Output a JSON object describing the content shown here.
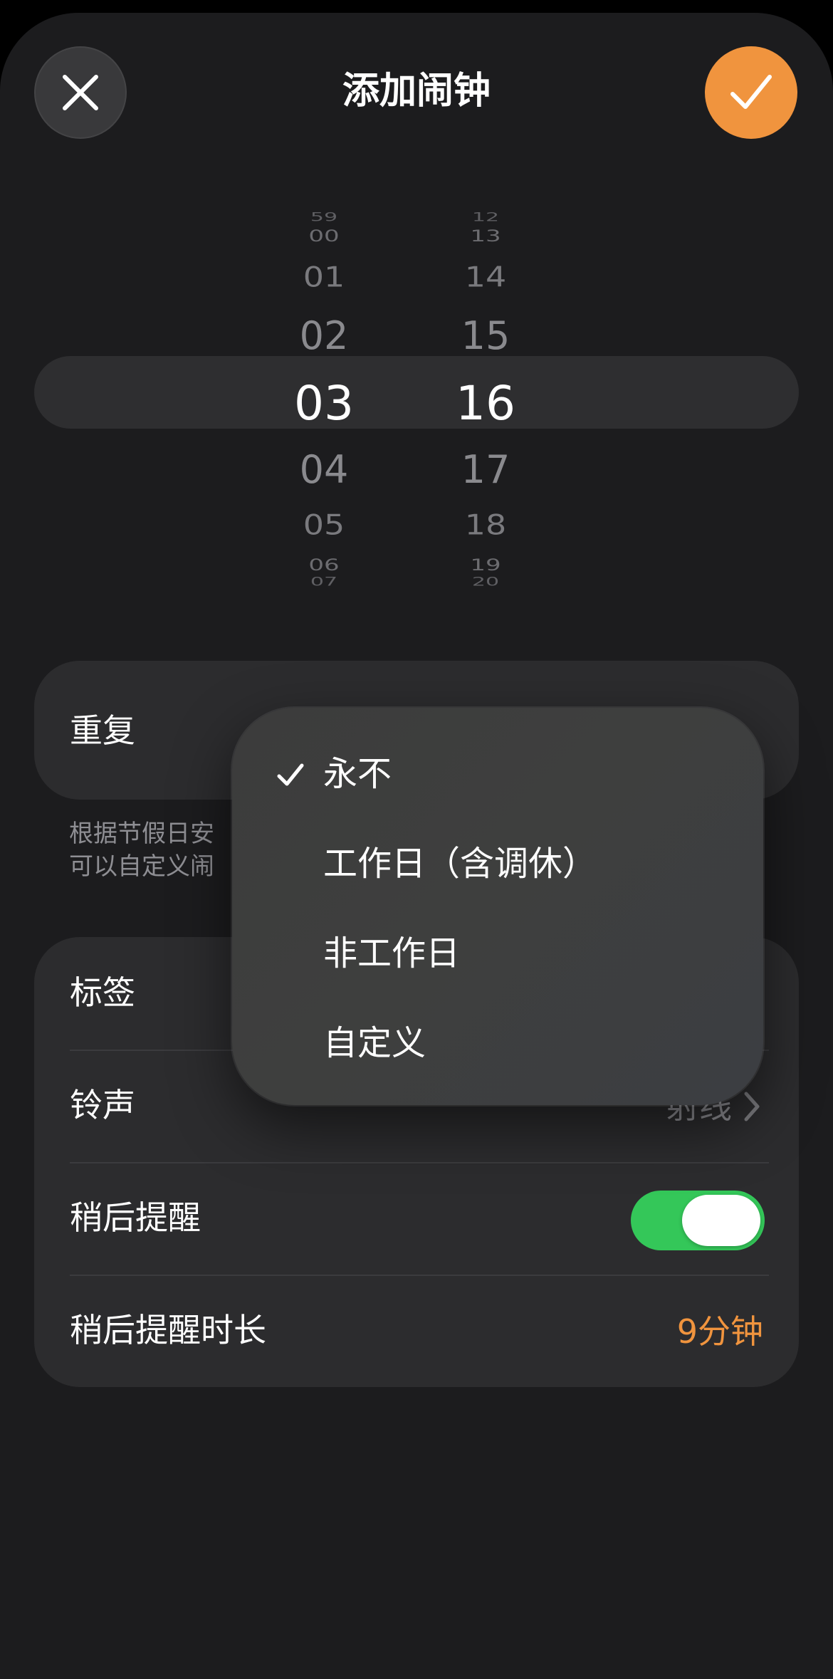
{
  "header": {
    "title": "添加闹钟",
    "close_icon": "close-icon",
    "confirm_icon": "checkmark-icon",
    "accent_color": "#f0943e"
  },
  "time_picker": {
    "hours": [
      "59",
      "00",
      "01",
      "02",
      "03",
      "04",
      "05",
      "06",
      "07"
    ],
    "minutes": [
      "12",
      "13",
      "14",
      "15",
      "16",
      "17",
      "18",
      "19",
      "20"
    ],
    "selected_hour": "03",
    "selected_minute": "16"
  },
  "repeat": {
    "label": "重复",
    "footnote_line1": "根据节假日安",
    "footnote_line2": "可以自定义闹"
  },
  "repeat_menu": {
    "selected": "永不",
    "items": [
      {
        "label": "永不",
        "checked": true
      },
      {
        "label": "工作日（含调休）",
        "checked": false
      },
      {
        "label": "非工作日",
        "checked": false
      },
      {
        "label": "自定义",
        "checked": false
      }
    ]
  },
  "settings": {
    "label_row": {
      "label": "标签"
    },
    "ringtone_row": {
      "label": "铃声",
      "value": "射线"
    },
    "snooze_row": {
      "label": "稍后提醒",
      "enabled": true,
      "toggle_color": "#34c759"
    },
    "snooze_duration_row": {
      "label": "稍后提醒时长",
      "value": "9分钟"
    }
  }
}
